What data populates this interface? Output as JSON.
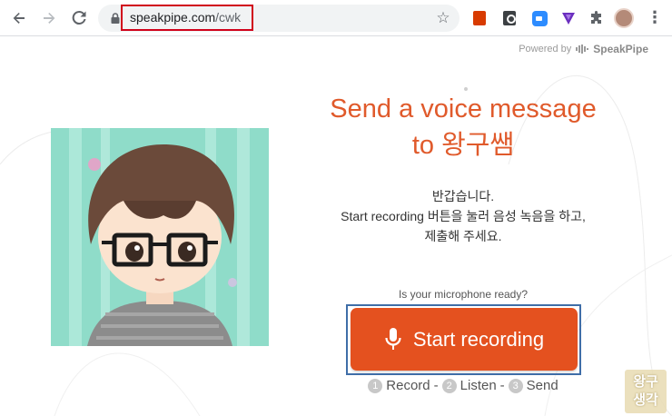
{
  "browser": {
    "url_domain": "speakpipe.com",
    "url_path": "/cwk",
    "icons": [
      "back-icon",
      "forward-icon",
      "reload-icon",
      "lock-icon",
      "star-icon",
      "extension-office-icon",
      "extension-key-icon",
      "extension-zoom-icon",
      "extension-v-icon",
      "extensions-puzzle-icon",
      "profile-avatar",
      "menu-kebab-icon"
    ]
  },
  "powered": {
    "label": "Powered by",
    "brand": "SpeakPipe"
  },
  "main": {
    "title_line1": "Send a voice message",
    "title_line2": "to 왕구쌤",
    "greeting_line1": "반갑습니다.",
    "greeting_line2": "Start recording 버튼을 눌러 음성 녹음을 하고,",
    "greeting_line3": "제출해 주세요.",
    "mic_ready": "Is your microphone ready?",
    "record_button": "Start recording",
    "steps": [
      {
        "num": "1",
        "label": "Record"
      },
      {
        "num": "2",
        "label": "Listen"
      },
      {
        "num": "3",
        "label": "Send"
      }
    ],
    "step_separator": "-"
  },
  "watermark": {
    "line1": "왕구",
    "line2": "생각"
  },
  "colors": {
    "accent": "#e05a2b",
    "button": "#e4511f",
    "focus_outline": "#3f6ea8",
    "url_highlight": "#d0021b"
  }
}
